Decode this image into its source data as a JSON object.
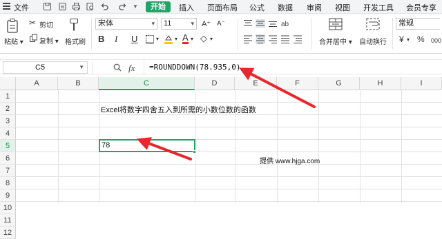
{
  "menubar": {
    "file_label": "文件",
    "start_tab": "开始",
    "tabs": [
      "插入",
      "页面布局",
      "公式",
      "数据",
      "审阅",
      "视图",
      "开发工具",
      "会员专享"
    ]
  },
  "ribbon": {
    "paste_label": "粘贴",
    "cut_label": "剪切",
    "copy_label": "复制",
    "format_painter_label": "格式刷",
    "font_name": "宋体",
    "font_size": "11",
    "merge_label": "合并居中",
    "wrap_label": "自动换行",
    "number_format": "常规",
    "bold": "B",
    "italic": "I",
    "underline": "U",
    "currency_symbol": "¥",
    "percent_symbol": "%",
    "thousands_symbol": "000",
    "fill_glyph": "A",
    "font_color_glyph": "A"
  },
  "formula_bar": {
    "cell_ref": "C5",
    "formula": "=ROUNDDOWN(78.935,0)",
    "fx_label": "fx"
  },
  "sheet": {
    "columns": [
      "A",
      "B",
      "C",
      "D",
      "E",
      "F",
      "G",
      "H",
      "I"
    ],
    "rows": [
      "1",
      "2",
      "3",
      "4",
      "5",
      "6",
      "7",
      "8",
      "9",
      "10",
      "11",
      "12"
    ],
    "c2_text": "Excel将数字四舍五入到所需的小数位数的函数",
    "c5_value": "78",
    "e7_text": "提供 www.hjga.com"
  },
  "colors": {
    "accent": "#21a366",
    "arrow": "#e8262b"
  }
}
